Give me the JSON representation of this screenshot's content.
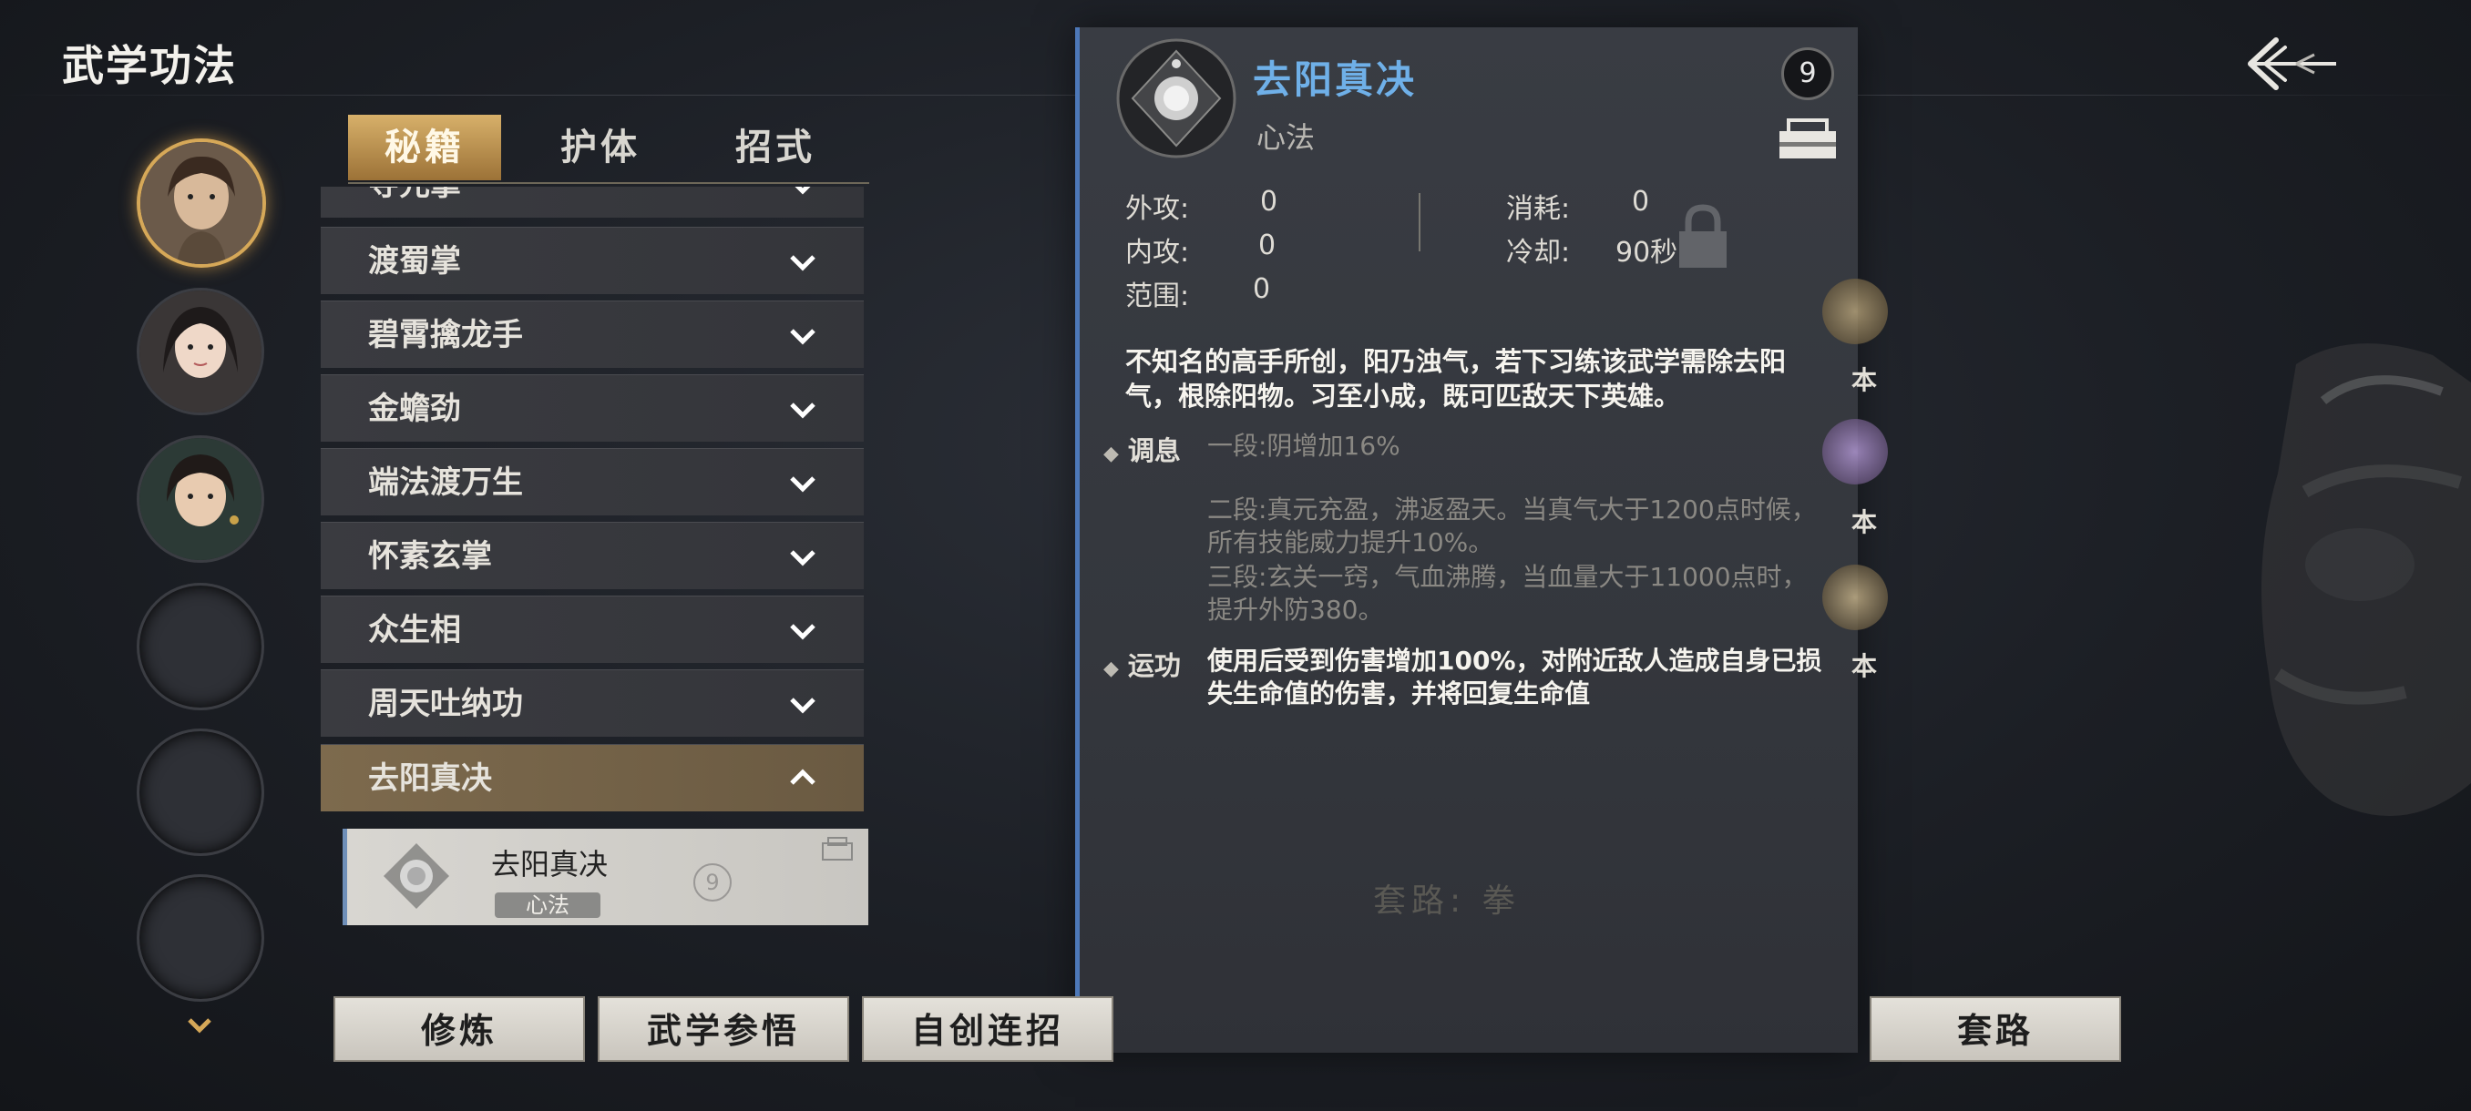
{
  "page": {
    "title": "武学功法"
  },
  "tabs": [
    {
      "label": "秘籍",
      "active": true
    },
    {
      "label": "护体",
      "active": false
    },
    {
      "label": "招式",
      "active": false
    }
  ],
  "skill_list": {
    "partial_label": "寺元掌",
    "items": [
      {
        "label": "渡蜀掌"
      },
      {
        "label": "碧霄擒龙手"
      },
      {
        "label": "金蟾劲"
      },
      {
        "label": "端法渡万生"
      },
      {
        "label": "怀素玄掌"
      },
      {
        "label": "众生相"
      },
      {
        "label": "周天吐纳功"
      },
      {
        "label": "去阳真决",
        "expanded": true
      }
    ],
    "sub_card": {
      "name": "去阳真决",
      "tag": "心法",
      "level": "9"
    }
  },
  "detail": {
    "name": "去阳真决",
    "type": "心法",
    "level": "9",
    "stats": {
      "outer_attack": {
        "label": "外攻:",
        "value": "0"
      },
      "inner_attack": {
        "label": "内攻:",
        "value": "0"
      },
      "range": {
        "label": "范围:",
        "value": "0"
      },
      "cost": {
        "label": "消耗:",
        "value": "0"
      },
      "cooldown": {
        "label": "冷却:",
        "value": "90秒"
      }
    },
    "description": "不知名的高手所创，阳乃浊气，若下习练该武学需除去阳气，根除阳物。习至小成，既可匹敌天下英雄。",
    "effects": [
      {
        "key": "调息",
        "lines": [
          {
            "text": "一段:阴增加16%",
            "dim": true
          },
          {
            "text": "二段:真元充盈，沸返盈天。当真气大于1200点时候，所有技能威力提升10%。",
            "dim": true
          },
          {
            "text": "三段:玄关一窍，气血沸腾，当血量大于11000点时，提升外防380。",
            "dim": true
          }
        ]
      },
      {
        "key": "运功",
        "lines": [
          {
            "text": "使用后受到伤害增加100%，对附近敌人造成自身已损失生命值的伤害，并将回复生命值",
            "dim": false
          }
        ]
      }
    ],
    "route_ghost": "套路: 拳"
  },
  "side_labels": [
    "本",
    "本",
    "本"
  ],
  "buttons": {
    "cultivate": "修炼",
    "comprehend": "武学参悟",
    "custom_combo": "自创连招",
    "routine": "套路"
  },
  "colors": {
    "accent_gold": "#d6a858",
    "title_blue": "#6fb0e8",
    "panel_border": "#4d78b8"
  }
}
